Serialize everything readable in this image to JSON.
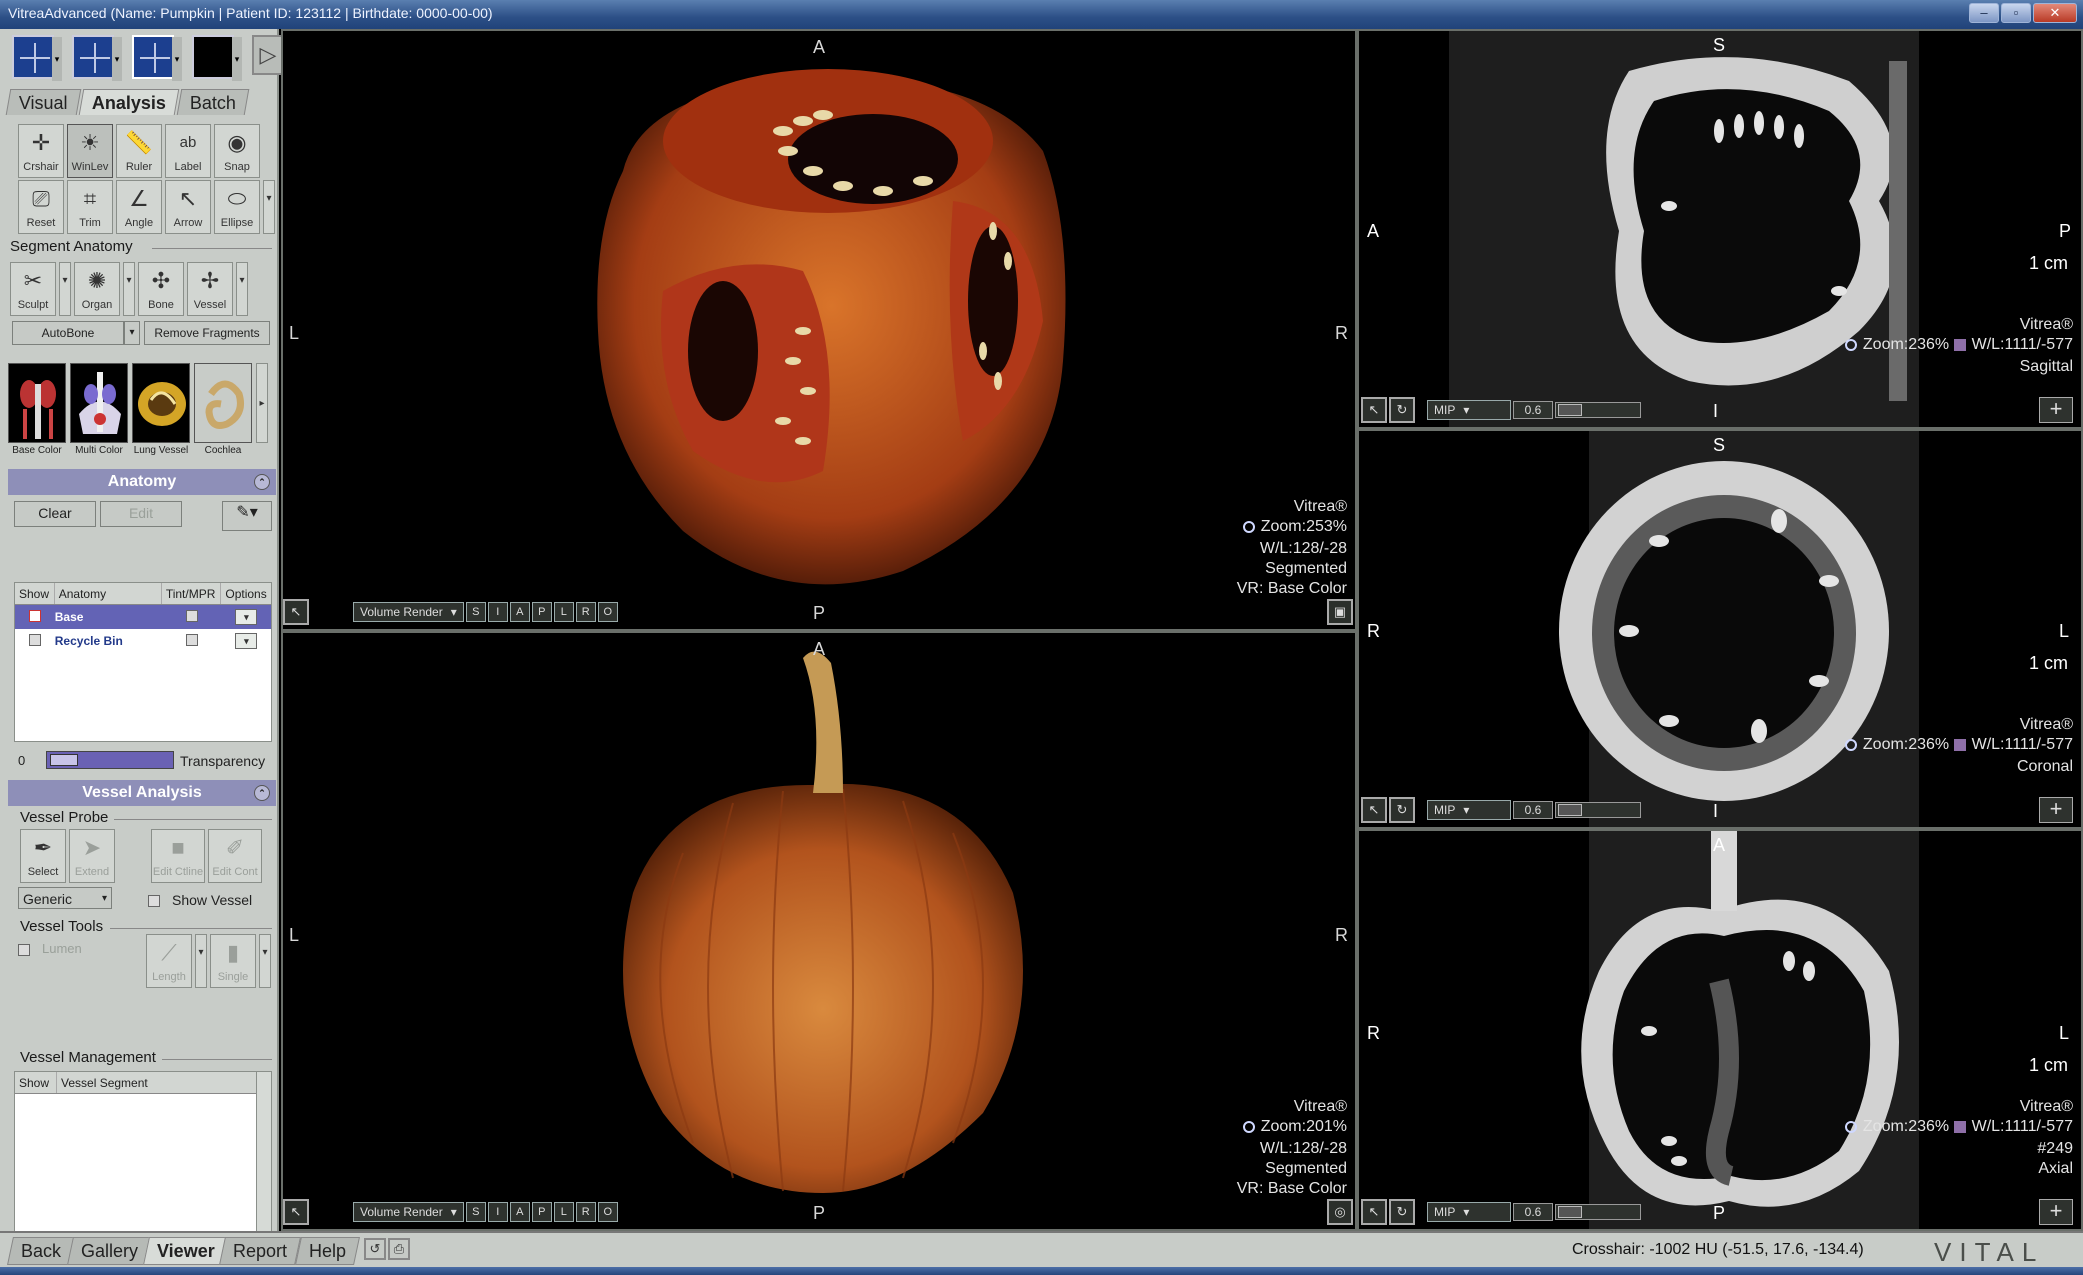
{
  "window": {
    "title": "VitreaAdvanced (Name: Pumpkin | Patient ID: 123112 | Birthdate: 0000-00-00)"
  },
  "left_panel": {
    "tabs": [
      "Visual",
      "Analysis",
      "Batch"
    ],
    "tools_row1": [
      "Crshair",
      "WinLev",
      "Ruler",
      "Label",
      "Snap"
    ],
    "tools_row2": [
      "Reset",
      "Trim",
      "Angle",
      "Arrow",
      "Ellipse"
    ],
    "segment_anatomy": {
      "title": "Segment Anatomy",
      "tools": [
        "Sculpt",
        "Organ",
        "Bone",
        "Vessel"
      ],
      "autobone": "AutoBone",
      "remove_fragments": "Remove Fragments"
    },
    "presets": [
      "Base Color",
      "Multi Color",
      "Lung Vessel",
      "Cochlea"
    ],
    "anatomy": {
      "title": "Anatomy",
      "clear": "Clear",
      "edit": "Edit",
      "headers": [
        "Show",
        "Anatomy",
        "Tint/MPR",
        "Options"
      ],
      "rows": [
        {
          "name": "Base",
          "selected": true
        },
        {
          "name": "Recycle Bin",
          "selected": false
        }
      ],
      "transparency_value": "0",
      "transparency_label": "Transparency"
    },
    "vessel_analysis": {
      "title": "Vessel Analysis",
      "probe_title": "Vessel Probe",
      "probe_tools": [
        "Select",
        "Extend",
        "Edit Ctline",
        "Edit Cont"
      ],
      "generic": "Generic",
      "show_vessel": "Show Vessel",
      "tools_title": "Vessel Tools",
      "lumen": "Lumen",
      "tool_buttons": [
        "Length",
        "Single"
      ]
    },
    "vessel_management": {
      "title": "Vessel Management",
      "headers": [
        "Show",
        "Vessel Segment"
      ]
    }
  },
  "viewports": {
    "vr_top": {
      "orient": {
        "top": "A",
        "bottom": "P",
        "left": "L",
        "right": "R"
      },
      "info": [
        "Vitrea®",
        "Zoom:253%",
        "W/L:128/-28",
        "Segmented",
        "VR: Base Color"
      ],
      "render_mode": "Volume Render",
      "axis_buttons": [
        "S",
        "I",
        "A",
        "P",
        "L",
        "R",
        "O"
      ]
    },
    "vr_bottom": {
      "orient": {
        "top": "A",
        "bottom": "P",
        "left": "L",
        "right": "R"
      },
      "info": [
        "Vitrea®",
        "Zoom:201%",
        "W/L:128/-28",
        "Segmented",
        "VR: Base Color"
      ],
      "render_mode": "Volume Render",
      "axis_buttons": [
        "S",
        "I",
        "A",
        "P",
        "L",
        "R",
        "O"
      ]
    },
    "sagittal": {
      "orient": {
        "top": "S",
        "bottom": "I",
        "left": "A",
        "right": "P"
      },
      "scale": "1 cm",
      "info": [
        "Vitrea®",
        "Zoom:236%",
        "W/L:1111/-577",
        "Sagittal"
      ],
      "mode": "MIP",
      "thickness": "0.6"
    },
    "coronal": {
      "orient": {
        "top": "S",
        "bottom": "I",
        "left": "R",
        "right": "L"
      },
      "scale": "1 cm",
      "info": [
        "Vitrea®",
        "Zoom:236%",
        "W/L:1111/-577",
        "Coronal"
      ],
      "mode": "MIP",
      "thickness": "0.6"
    },
    "axial": {
      "orient": {
        "top": "A",
        "bottom": "P",
        "left": "R",
        "right": "L"
      },
      "scale": "1 cm",
      "info": [
        "Vitrea®",
        "Zoom:236%",
        "W/L:1111/-577",
        "#249",
        "Axial"
      ],
      "mode": "MIP",
      "thickness": "0.6"
    }
  },
  "bottom": {
    "tabs": [
      "Back",
      "Gallery",
      "Viewer",
      "Report",
      "Help"
    ],
    "active_tab": "Viewer",
    "crosshair": "Crosshair: -1002 HU (-51.5, 17.6, -134.4)",
    "brand": "VITAL"
  },
  "colors": {
    "selection": "#6363b5",
    "panel": "#c8ccc8",
    "header_bar": "#8e8fb8",
    "title_bar": "#2c4f86"
  }
}
